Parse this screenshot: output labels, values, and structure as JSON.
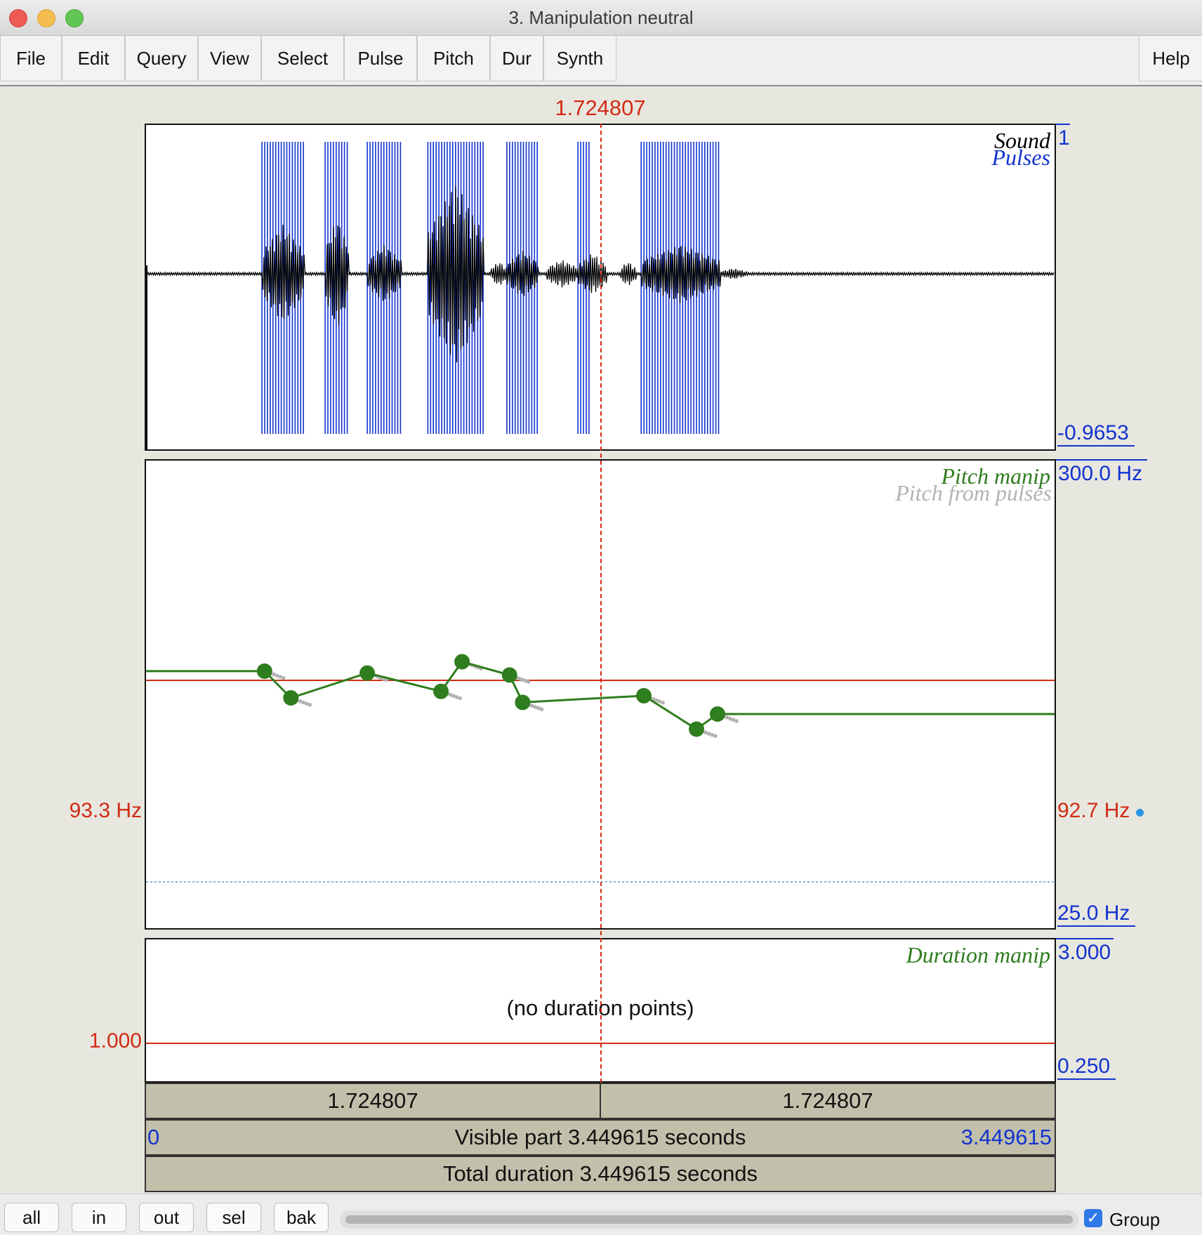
{
  "window": {
    "title": "3. Manipulation neutral"
  },
  "menu": [
    "File",
    "Edit",
    "Query",
    "View",
    "Select",
    "Pulse",
    "Pitch",
    "Dur",
    "Synth"
  ],
  "help": "Help",
  "cursor_time": "1.724807",
  "sound": {
    "legend_sound": "Sound",
    "legend_pulses": "Pulses",
    "top_value": "1",
    "bottom_value": "-0.9653"
  },
  "pitch": {
    "legend_manip": "Pitch manip",
    "legend_from_pulses": "Pitch from pulses",
    "top_value": "300.0 Hz",
    "bottom_value": "25.0 Hz",
    "left_value": "93.3 Hz",
    "right_value": "92.7 Hz"
  },
  "duration": {
    "legend": "Duration manip",
    "top_value": "3.000",
    "bottom_value": "0.250",
    "left_value": "1.000",
    "message": "(no duration points)"
  },
  "time_boxes": {
    "left": "1.724807",
    "right": "1.724807",
    "visible_start": "0",
    "visible_label": "Visible part 3.449615 seconds",
    "visible_end": "3.449615",
    "total_label": "Total duration 3.449615 seconds"
  },
  "buttons": [
    "all",
    "in",
    "out",
    "sel",
    "bak"
  ],
  "group": {
    "label": "Group",
    "checked": true
  },
  "colors": {
    "cursor": "#d12b14",
    "pulses": "#1233cf",
    "pitch": "#2e7d1e",
    "pitch_points": "#b3b3b3"
  },
  "chart_data": {
    "type": "line",
    "x_range_seconds": [
      0,
      3.449615
    ],
    "y_range_hz": [
      25.0,
      300.0
    ],
    "pitch_manip_points_hz": [
      {
        "t": 0.45,
        "f": 98
      },
      {
        "t": 0.55,
        "f": 85
      },
      {
        "t": 0.84,
        "f": 97
      },
      {
        "t": 1.12,
        "f": 88
      },
      {
        "t": 1.2,
        "f": 103
      },
      {
        "t": 1.38,
        "f": 96
      },
      {
        "t": 1.43,
        "f": 83
      },
      {
        "t": 1.89,
        "f": 86
      },
      {
        "t": 2.09,
        "f": 72
      },
      {
        "t": 2.17,
        "f": 78
      }
    ]
  }
}
